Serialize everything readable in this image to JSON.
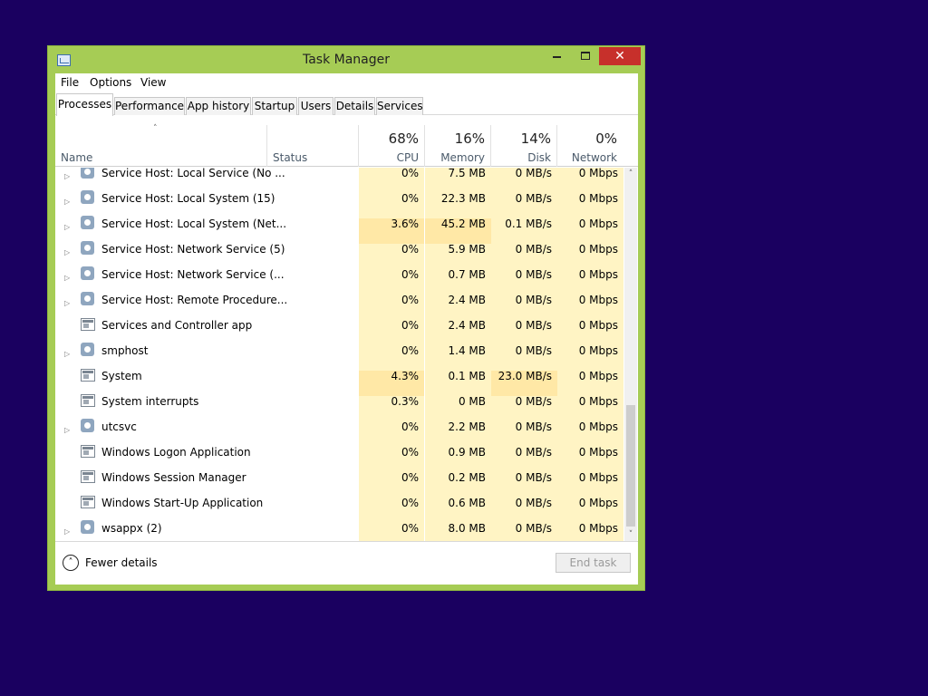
{
  "window": {
    "title": "Task Manager",
    "controls": {
      "minimize": "minimize",
      "maximize": "maximize",
      "close": "✕"
    }
  },
  "menu": [
    "File",
    "Options",
    "View"
  ],
  "tabs": [
    "Processes",
    "Performance",
    "App history",
    "Startup",
    "Users",
    "Details",
    "Services"
  ],
  "active_tab": "Processes",
  "columns": {
    "name": "Name",
    "status": "Status",
    "cpu": {
      "pct": "68%",
      "label": "CPU"
    },
    "memory": {
      "pct": "16%",
      "label": "Memory"
    },
    "disk": {
      "pct": "14%",
      "label": "Disk"
    },
    "network": {
      "pct": "0%",
      "label": "Network"
    }
  },
  "sort_indicator": "˄",
  "processes": [
    {
      "name": "Service Host: Local Service (No ...",
      "icon": "gear-icon",
      "expandable": true,
      "cpu": "0%",
      "memory": "7.5 MB",
      "disk": "0 MB/s",
      "network": "0 Mbps"
    },
    {
      "name": "Service Host: Local System (15)",
      "icon": "gear-icon",
      "expandable": true,
      "cpu": "0%",
      "memory": "22.3 MB",
      "disk": "0 MB/s",
      "network": "0 Mbps"
    },
    {
      "name": "Service Host: Local System (Net...",
      "icon": "gear-icon",
      "expandable": true,
      "cpu": "3.6%",
      "memory": "45.2 MB",
      "disk": "0.1 MB/s",
      "network": "0 Mbps"
    },
    {
      "name": "Service Host: Network Service (5)",
      "icon": "gear-icon",
      "expandable": true,
      "cpu": "0%",
      "memory": "5.9 MB",
      "disk": "0 MB/s",
      "network": "0 Mbps"
    },
    {
      "name": "Service Host: Network Service (...",
      "icon": "gear-icon",
      "expandable": true,
      "cpu": "0%",
      "memory": "0.7 MB",
      "disk": "0 MB/s",
      "network": "0 Mbps"
    },
    {
      "name": "Service Host: Remote Procedure...",
      "icon": "gear-icon",
      "expandable": true,
      "cpu": "0%",
      "memory": "2.4 MB",
      "disk": "0 MB/s",
      "network": "0 Mbps"
    },
    {
      "name": "Services and Controller app",
      "icon": "app-window-icon",
      "expandable": false,
      "cpu": "0%",
      "memory": "2.4 MB",
      "disk": "0 MB/s",
      "network": "0 Mbps"
    },
    {
      "name": "smphost",
      "icon": "gear-icon",
      "expandable": true,
      "cpu": "0%",
      "memory": "1.4 MB",
      "disk": "0 MB/s",
      "network": "0 Mbps"
    },
    {
      "name": "System",
      "icon": "app-window-icon",
      "expandable": false,
      "cpu": "4.3%",
      "memory": "0.1 MB",
      "disk": "23.0 MB/s",
      "network": "0 Mbps"
    },
    {
      "name": "System interrupts",
      "icon": "app-window-icon",
      "expandable": false,
      "cpu": "0.3%",
      "memory": "0 MB",
      "disk": "0 MB/s",
      "network": "0 Mbps"
    },
    {
      "name": "utcsvc",
      "icon": "gear-icon",
      "expandable": true,
      "cpu": "0%",
      "memory": "2.2 MB",
      "disk": "0 MB/s",
      "network": "0 Mbps"
    },
    {
      "name": "Windows Logon Application",
      "icon": "app-window-icon",
      "expandable": false,
      "cpu": "0%",
      "memory": "0.9 MB",
      "disk": "0 MB/s",
      "network": "0 Mbps"
    },
    {
      "name": "Windows Session Manager",
      "icon": "app-window-icon",
      "expandable": false,
      "cpu": "0%",
      "memory": "0.2 MB",
      "disk": "0 MB/s",
      "network": "0 Mbps"
    },
    {
      "name": "Windows Start-Up Application",
      "icon": "app-window-icon",
      "expandable": false,
      "cpu": "0%",
      "memory": "0.6 MB",
      "disk": "0 MB/s",
      "network": "0 Mbps"
    },
    {
      "name": "wsappx (2)",
      "icon": "gear-icon",
      "expandable": true,
      "cpu": "0%",
      "memory": "8.0 MB",
      "disk": "0 MB/s",
      "network": "0 Mbps"
    }
  ],
  "footer": {
    "fewer_details": "Fewer details",
    "end_task": "End task"
  },
  "colors": {
    "desktop": "#1a0060",
    "frame": "#a6cc55",
    "close": "#c7302b",
    "heat_low": "#fff4c4",
    "heat_mid": "#ffe8a6"
  }
}
